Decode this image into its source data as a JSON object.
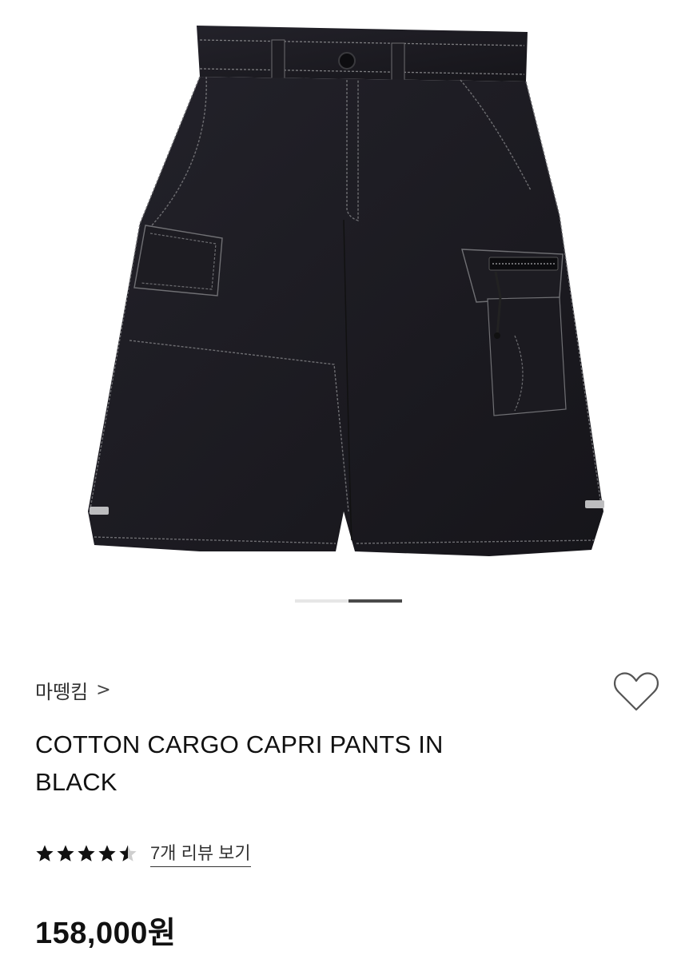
{
  "product": {
    "image_alt": "black cargo shorts product photo",
    "carousel": {
      "total_slides": 2,
      "active_slide": 2
    },
    "brand": "마뗑킴",
    "brand_chevron": ">",
    "title": "COTTON CARGO CAPRI PANTS IN BLACK",
    "rating": {
      "value": 4.5,
      "max": 5
    },
    "review_link": "7개 리뷰 보기",
    "price": "158,000원"
  },
  "icons": {
    "wishlist": "heart-outline-icon",
    "star": "star-icon"
  },
  "colors": {
    "garment": "#1c1b20",
    "stitch": "#8a8a8a",
    "star_fill": "#111111",
    "indicator_active": "#4a4a4a",
    "indicator_inactive": "#e6e6e6"
  }
}
